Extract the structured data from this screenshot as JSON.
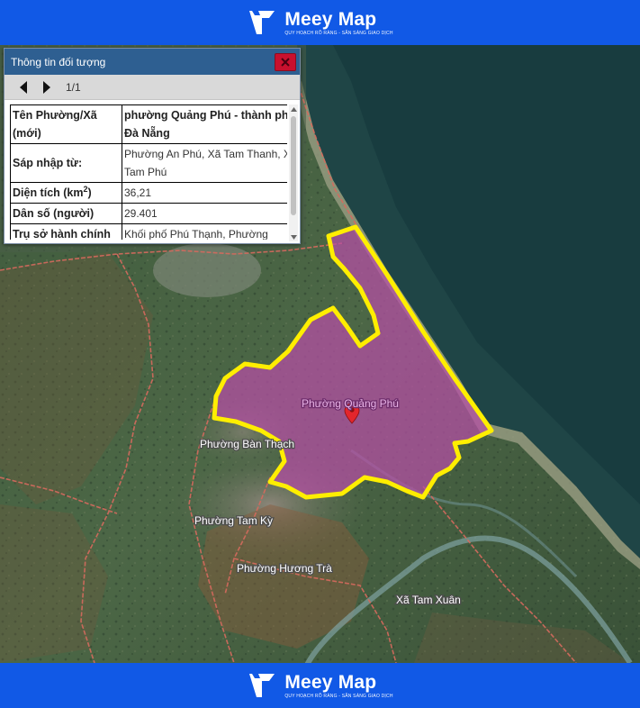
{
  "brand": {
    "name": "Meey Map",
    "tagline": "QUY HOẠCH RÕ RÀNG - SẴN SÀNG GIAO DỊCH",
    "accent_color": "#1159e6"
  },
  "map": {
    "highlight_color": "#ffee00",
    "highlight_fill": "#b74ea6",
    "marker_icon": "map-pin-icon",
    "labels": {
      "quang_phu": "Phường Quảng Phú",
      "ban_thach": "Phường Bàn Thạch",
      "tam_ky": "Phường Tam Kỳ",
      "huong_tra": "Phường Hương Trà",
      "tam_xuan": "Xã Tam Xuân"
    }
  },
  "panel": {
    "title": "Thông tin đối tượng",
    "close_icon": "close-icon",
    "pager": "1/1",
    "rows": [
      {
        "key": "Tên Phường/Xã (mới)",
        "value": "phường Quảng Phú - thành phố Đà Nẵng"
      },
      {
        "key": "Sáp nhập từ:",
        "value": "Phường An Phú, Xã Tam Thanh, Xã Tam Phú"
      },
      {
        "key": "Diện tích (km2)",
        "value": "36,21"
      },
      {
        "key": "Dân số (người)",
        "value": "29.401"
      },
      {
        "key": "Trụ sở hành chính (mới)",
        "value": "Khối phố Phú Thạnh, Phường Quảng Phú"
      }
    ]
  }
}
